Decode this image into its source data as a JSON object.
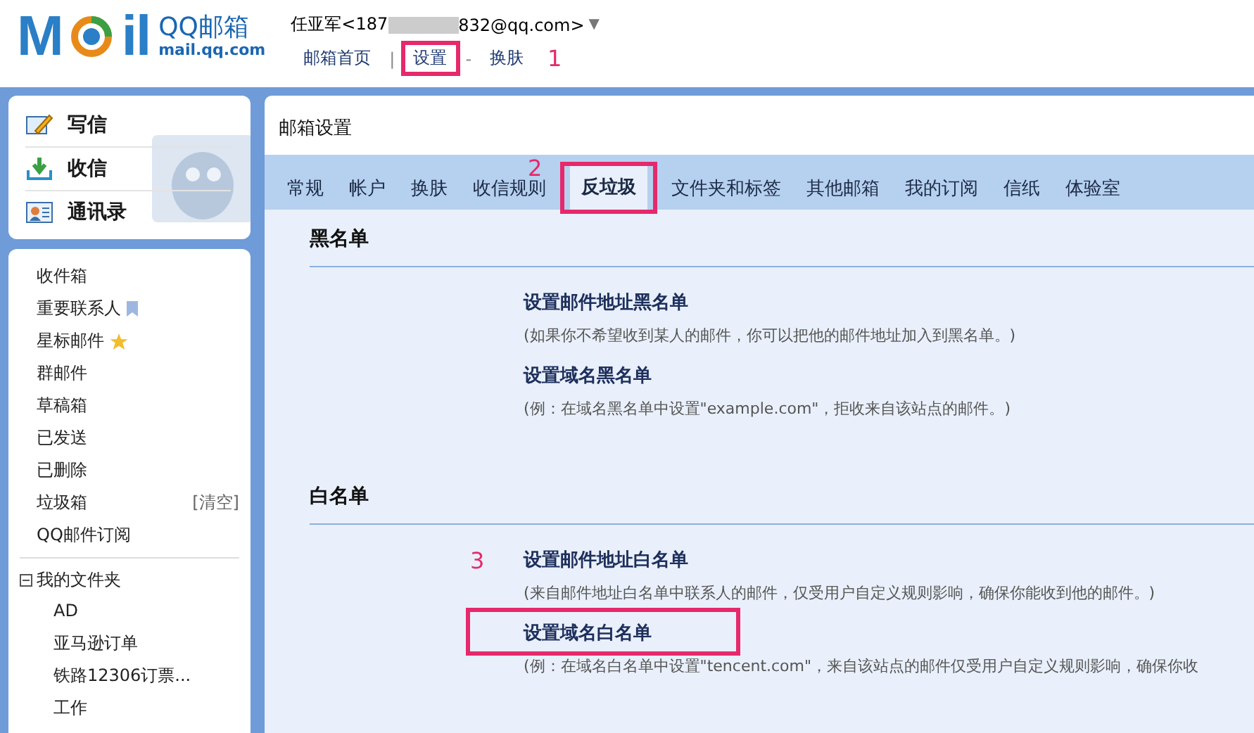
{
  "header": {
    "logo": {
      "left": "M",
      "right": "il",
      "name": "QQ邮箱",
      "domain": "mail.qq.com"
    },
    "user": {
      "name_start": "任亚军<187",
      "name_end": "832@qq.com>",
      "caret": "▼"
    },
    "links": [
      {
        "label": "邮箱首页",
        "framed": false
      },
      {
        "separator": "|",
        "label": "设置",
        "framed": true
      },
      {
        "separator": "-",
        "label": "换肤",
        "framed": false
      }
    ]
  },
  "sidebar": {
    "actions": [
      "写信",
      "收信",
      "通讯录"
    ],
    "folders": [
      {
        "label": "收件箱",
        "kind": "plain"
      },
      {
        "label": "重要联系人",
        "kind": "bookmark"
      },
      {
        "label": "星标邮件",
        "kind": "star"
      },
      {
        "label": "群邮件",
        "kind": "plain"
      },
      {
        "label": "草稿箱",
        "kind": "plain"
      },
      {
        "label": "已发送",
        "kind": "plain"
      },
      {
        "label": "已删除",
        "kind": "plain"
      },
      {
        "label": "垃圾箱",
        "kind": "plain",
        "action": "[清空]"
      },
      {
        "label": "QQ邮件订阅",
        "kind": "plain"
      }
    ],
    "my_folders": {
      "label": "我的文件夹",
      "expanded": true,
      "children": [
        {
          "label": "AD"
        },
        {
          "label": "亚马逊订单"
        },
        {
          "label": "铁路12306订票..."
        },
        {
          "label": "工作"
        }
      ]
    }
  },
  "main": {
    "title": "邮箱设置",
    "tabs": [
      {
        "label": "常规",
        "selected": false,
        "framed": false
      },
      {
        "label": "帐户",
        "selected": false,
        "framed": false
      },
      {
        "label": "换肤",
        "selected": false,
        "framed": false
      },
      {
        "label": "收信规则",
        "selected": false,
        "framed": false
      },
      {
        "label": "反垃圾",
        "selected": true,
        "framed": true
      },
      {
        "label": "文件夹和标签",
        "selected": false,
        "framed": false
      },
      {
        "label": "其他邮箱",
        "selected": false,
        "framed": false
      },
      {
        "label": "我的订阅",
        "selected": false,
        "framed": false
      },
      {
        "label": "信纸",
        "selected": false,
        "framed": false
      },
      {
        "label": "体验室",
        "selected": false,
        "framed": false
      }
    ],
    "sections": [
      {
        "heading": "黑名单",
        "items": [
          {
            "link": "设置邮件地址黑名单",
            "note": "(如果你不希望收到某人的邮件，你可以把他的邮件地址加入到黑名单。)",
            "framed": false
          },
          {
            "link": "设置域名黑名单",
            "note": "(例：在域名黑名单中设置\"example.com\"，拒收来自该站点的邮件。)",
            "framed": false
          }
        ]
      },
      {
        "heading": "白名单",
        "items": [
          {
            "link": "设置邮件地址白名单",
            "note": "(来自邮件地址白名单中联系人的邮件，仅受用户自定义规则影响，确保你能收到他的邮件。)",
            "framed": false
          },
          {
            "link": "设置域名白名单",
            "note": "(例：在域名白名单中设置\"tencent.com\"，来自该站点的邮件仅受用户自定义规则影响，确保你收",
            "framed": true
          }
        ]
      }
    ]
  },
  "annotations": [
    "1",
    "2",
    "3"
  ]
}
